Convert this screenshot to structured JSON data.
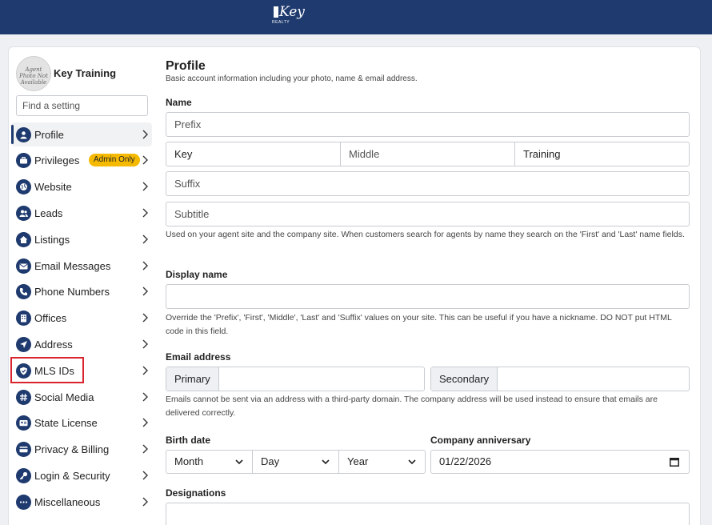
{
  "header": {
    "logo_word": "Key",
    "logo_sub": "REALTY"
  },
  "sidebar": {
    "avatar_text": "Agent Photo Not Available",
    "user_name": "Key Training",
    "search_placeholder": "Find a setting",
    "items": [
      {
        "label": "Profile",
        "icon": "user-icon"
      },
      {
        "label": "Privileges",
        "icon": "briefcase-icon",
        "badge": "Admin Only"
      },
      {
        "label": "Website",
        "icon": "globe-icon"
      },
      {
        "label": "Leads",
        "icon": "users-icon"
      },
      {
        "label": "Listings",
        "icon": "house-icon"
      },
      {
        "label": "Email Messages",
        "icon": "envelope-icon"
      },
      {
        "label": "Phone Numbers",
        "icon": "phone-icon"
      },
      {
        "label": "Offices",
        "icon": "building-icon"
      },
      {
        "label": "Address",
        "icon": "location-arrow-icon"
      },
      {
        "label": "MLS IDs",
        "icon": "shield-icon"
      },
      {
        "label": "Social Media",
        "icon": "hashtag-icon"
      },
      {
        "label": "State License",
        "icon": "id-card-icon"
      },
      {
        "label": "Privacy & Billing",
        "icon": "credit-card-icon"
      },
      {
        "label": "Login & Security",
        "icon": "key-icon"
      },
      {
        "label": "Miscellaneous",
        "icon": "ellipsis-icon"
      }
    ],
    "highlight_color": "#d9232d"
  },
  "profile": {
    "title": "Profile",
    "subtitle": "Basic account information including your photo, name & email address.",
    "name": {
      "label": "Name",
      "prefix_placeholder": "Prefix",
      "first": "Key",
      "middle_placeholder": "Middle",
      "last": "Training",
      "suffix_placeholder": "Suffix",
      "subtitle_placeholder": "Subtitle",
      "help": "Used on your agent site and the company site. When customers search for agents by name they search on the 'First' and 'Last' name fields."
    },
    "display_name": {
      "label": "Display name",
      "value": "",
      "help": "Override the 'Prefix', 'First', 'Middle', 'Last' and 'Suffix' values on your site. This can be useful if you have a nickname. DO NOT put HTML code in this field."
    },
    "email": {
      "label": "Email address",
      "primary_label": "Primary",
      "primary_value": "",
      "secondary_label": "Secondary",
      "secondary_value": "",
      "help": "Emails cannot be sent via an address with a third-party domain. The company address will be used instead to ensure that emails are delivered correctly."
    },
    "birth_date": {
      "label": "Birth date",
      "month": "Month",
      "day": "Day",
      "year": "Year"
    },
    "anniversary": {
      "label": "Company anniversary",
      "value": "01/22/2026"
    },
    "designations": {
      "label": "Designations",
      "value": ""
    }
  },
  "colors": {
    "header_bg": "#1e3a6e",
    "badge_bg": "#f5b900",
    "icon_bg": "#1e3a6e"
  }
}
